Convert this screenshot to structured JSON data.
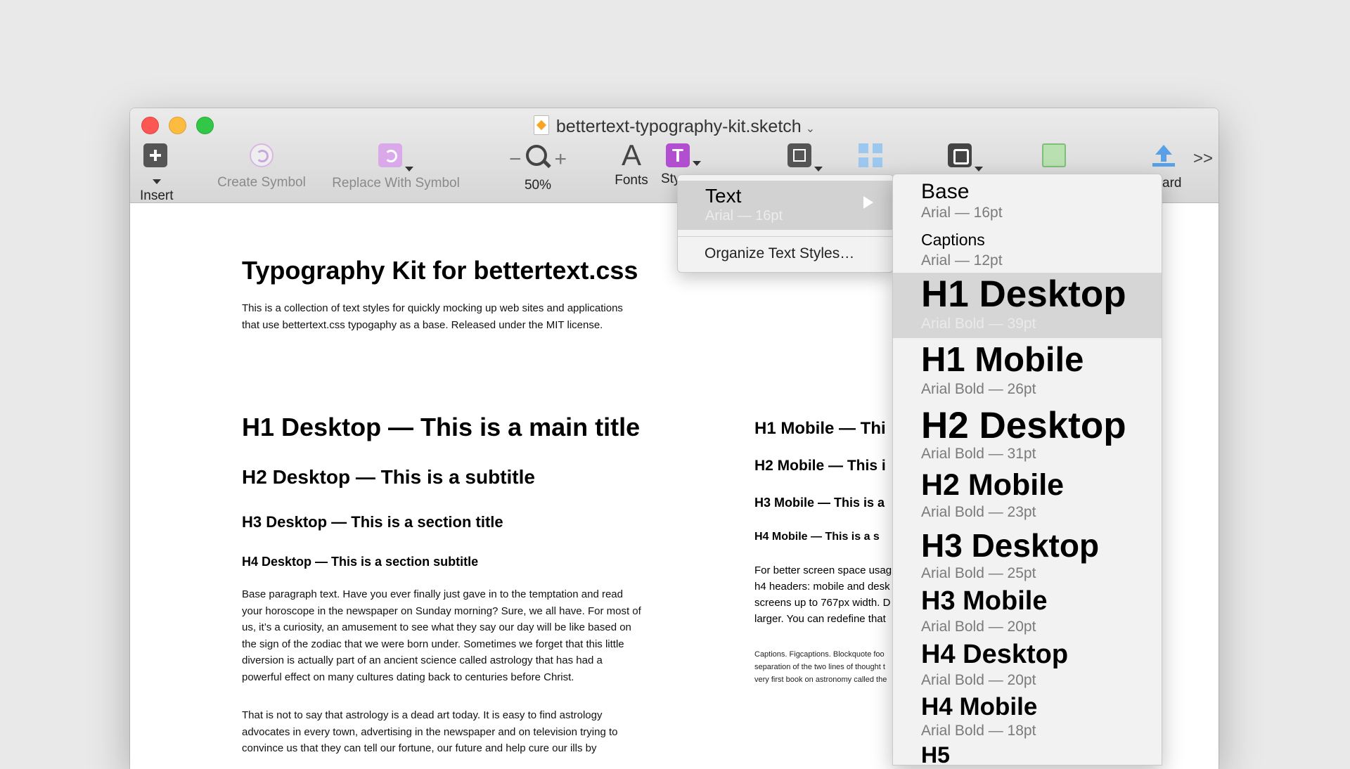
{
  "window": {
    "title": "bettertext-typography-kit.sketch"
  },
  "toolbar": {
    "insert": "Insert",
    "create_symbol": "Create Symbol",
    "replace_with_symbol": "Replace With Symbol",
    "zoom": "50%",
    "fonts": "Fonts",
    "styles": "Sty",
    "forward": "ard"
  },
  "doc": {
    "title": "Typography Kit for bettertext.css",
    "intro": "This is a collection of text styles for quickly mocking up web sites and applications that use bettertext.css typogaphy as a base. Released under the MIT license.",
    "h1_desktop": "H1 Desktop — This is a main title",
    "h2_desktop": "H2 Desktop — This is a subtitle",
    "h3_desktop": "H3 Desktop — This is a section title",
    "h4_desktop": "H4 Desktop — This is a section subtitle",
    "para1": "Base paragraph text. Have you ever finally just gave in to the temptation and read your horoscope in the newspaper on Sunday morning? Sure, we all have. For most of us, it’s a curiosity, an amusement to see what they say our day will be like based on the sign of the zodiac that we were born under. Sometimes we forget that this little diversion is actually part of an ancient science called astrology that has had a powerful effect on many cultures dating back to centuries before Christ.",
    "para2": "That is not to say that astrology is a dead art today. It is easy to find astrology advocates in every town, advertising in the newspaper and on television trying to convince us that they can tell our fortune, our future and help cure our ills by",
    "h1_mobile": "H1 Mobile — Thi",
    "h2_mobile": "H2 Mobile — This i",
    "h3_mobile": "H3 Mobile — This is a",
    "h4_mobile": "H4 Mobile — This is a s",
    "mob_para": [
      "For better screen space usag",
      "h4 headers: mobile and desk",
      "screens up to 767px width. D",
      "larger. You can redefine that"
    ],
    "captions": [
      "Captions. Figcaptions. Blockquote foo",
      "separation of the two lines of thought t",
      "very first book on astronomy called the"
    ]
  },
  "menu": {
    "text_item": "Text",
    "text_sub": "Arial — 16pt",
    "organize": "Organize Text Styles…"
  },
  "styles": [
    {
      "name": "Base",
      "sub": "Arial — 16pt"
    },
    {
      "name": "Captions",
      "sub": "Arial — 12pt"
    },
    {
      "name": "H1 Desktop",
      "sub": "Arial Bold — 39pt"
    },
    {
      "name": "H1 Mobile",
      "sub": "Arial Bold — 26pt"
    },
    {
      "name": "H2 Desktop",
      "sub": "Arial Bold — 31pt"
    },
    {
      "name": "H2 Mobile",
      "sub": "Arial Bold — 23pt"
    },
    {
      "name": "H3 Desktop",
      "sub": "Arial Bold — 25pt"
    },
    {
      "name": "H3 Mobile",
      "sub": "Arial Bold — 20pt"
    },
    {
      "name": "H4 Desktop",
      "sub": "Arial Bold — 20pt"
    },
    {
      "name": "H4 Mobile",
      "sub": "Arial Bold — 18pt"
    },
    {
      "name": "H5",
      "sub": ""
    }
  ]
}
